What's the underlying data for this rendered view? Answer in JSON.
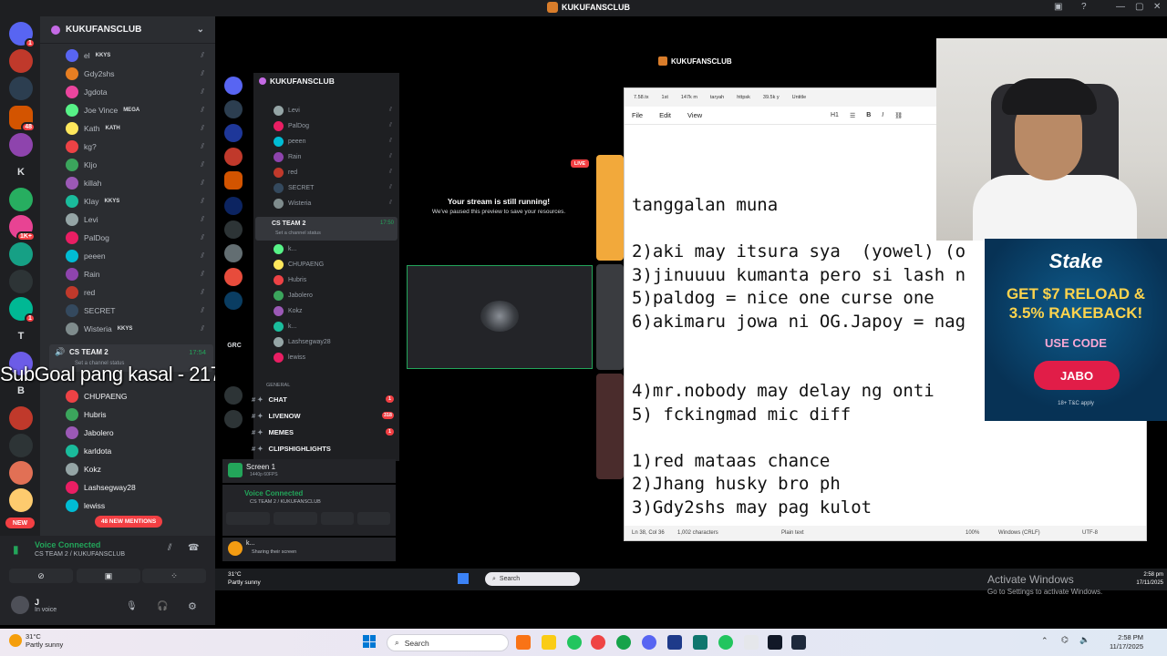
{
  "app": {
    "title": "KUKUFANSCLUB",
    "server_name": "KUKUFANSCLUB"
  },
  "overlay": {
    "subgoal": "SubGoal pang kasal - 217/3000"
  },
  "sidebar": {
    "members_top": [
      {
        "name": "el",
        "tag": "KKYS"
      },
      {
        "name": "Gdy2shs"
      },
      {
        "name": "Jgdota"
      },
      {
        "name": "Joe Vince",
        "tag": "MEGA"
      },
      {
        "name": "Kath",
        "tag": "KATH"
      },
      {
        "name": "kg?"
      },
      {
        "name": "Kljo"
      },
      {
        "name": "killah"
      },
      {
        "name": "Klay",
        "tag": "KKYS"
      },
      {
        "name": "Levi"
      },
      {
        "name": "PalDog"
      },
      {
        "name": "peeen"
      },
      {
        "name": "Rain"
      },
      {
        "name": "red"
      },
      {
        "name": "SECRET"
      },
      {
        "name": "Wisteria",
        "tag": "KKYS"
      }
    ],
    "voice_channel": {
      "name": "CS TEAM 2",
      "time": "17:54",
      "status": "Set a channel status"
    },
    "members_bottom": [
      {
        "name": "CHUPAENG"
      },
      {
        "name": "Hubris"
      },
      {
        "name": "Jabolero"
      },
      {
        "name": "karldota"
      },
      {
        "name": "Kokz"
      },
      {
        "name": "Lashsegway28"
      },
      {
        "name": "lewiss"
      }
    ],
    "new_mentions": "48 NEW MENTIONS"
  },
  "rail": {
    "new_label": "NEW",
    "letters": [
      "K",
      "T",
      "B"
    ]
  },
  "voice_panel": {
    "status": "Voice Connected",
    "channel": "CS TEAM 2 / KUKUFANSCLUB",
    "user_name": "J",
    "user_status": "In voice"
  },
  "taskbar": {
    "temperature": "31°C",
    "weather": "Partly sunny",
    "search": "Search",
    "time": "2:58 PM",
    "date": "11/17/2025"
  },
  "stream": {
    "window_title": "KUKUFANSCLUB",
    "paused_title": "Your stream is still running!",
    "paused_sub": "We've paused this preview to save your resources.",
    "live": "LIVE",
    "embed_server": "KUKUFANSCLUB",
    "embed_members": [
      "Levi",
      "PalDog",
      "peeen",
      "Rain",
      "red",
      "SECRET",
      "Wisteria"
    ],
    "embed_voice_channel": "CS TEAM 2",
    "embed_voice_time": "17:50",
    "embed_voice_status": "Set a channel status",
    "embed_members2": [
      "k...",
      "CHUPAENG",
      "Hubris",
      "Jabolero",
      "Kokz",
      "k...",
      "Lashsegway28",
      "lewiss"
    ],
    "embed_rail_label": "GRC",
    "general_label": "GENERAL",
    "embed_channels": [
      {
        "name": "CHAT",
        "badge": "1"
      },
      {
        "name": "LIVENOW",
        "badge": "318"
      },
      {
        "name": "MEMES",
        "badge": "1"
      },
      {
        "name": "CLIPSHIGHLIGHTS",
        "badge": ""
      }
    ],
    "screen_label": "Screen 1",
    "screen_sub": "1440p 60FPS",
    "embed_voice_connected": "Voice Connected",
    "embed_voice_sub": "CS TEAM 2 / KUKUFANSCLUB",
    "embed_user": "k...",
    "embed_user_status": "Sharing their screen",
    "embed_weather_temp": "31°C",
    "embed_weather": "Partly sunny",
    "embed_search": "Search",
    "embed_time": "2:58 pm",
    "embed_date": "17/11/2025",
    "embed_lang": "ENG\nUS"
  },
  "notepad": {
    "tabs": [
      "7.58.tx",
      "1st",
      "147k m",
      "taryah",
      "httpsk",
      "39.5k y",
      "Untitle"
    ],
    "menu": [
      "File",
      "Edit",
      "View"
    ],
    "format": [
      "H1",
      "B",
      "I"
    ],
    "lines": [
      "tanggalan muna",
      "",
      "2)aki may itsura sya  (yowel) (o",
      "3)jinuuuu kumanta pero si lash n",
      "5)paldog = nice one curse one",
      "6)akimaru jowa ni OG.Japoy = nag",
      "",
      "",
      "4)mr.nobody may delay ng onti",
      "5) fckingmad mic diff",
      "",
      "1)red mataas chance",
      "2)Jhang husky bro ph",
      "3)Gdy2shs may pag kulot"
    ],
    "status_pos": "Ln 38, Col 36",
    "status_chars": "1,002 characters",
    "status_fmt": "Plain text",
    "status_zoom": "100%",
    "status_eol": "Windows (CRLF)",
    "status_enc": "UTF-8"
  },
  "stake_ad": {
    "brand": "Stake",
    "promo_line1": "GET $7 RELOAD &",
    "promo_line2": "3.5% RAKEBACK!",
    "use_code": "USE CODE",
    "code": "JABO",
    "fine": "18+ T&C apply"
  },
  "activate": {
    "title": "Activate Windows",
    "sub": "Go to Settings to activate Windows."
  },
  "colors": {
    "discord_bg": "#2b2d31",
    "discord_dark": "#1e1f22",
    "green": "#23a55a",
    "red": "#f23f43",
    "ad_yellow": "#fcd34d"
  }
}
